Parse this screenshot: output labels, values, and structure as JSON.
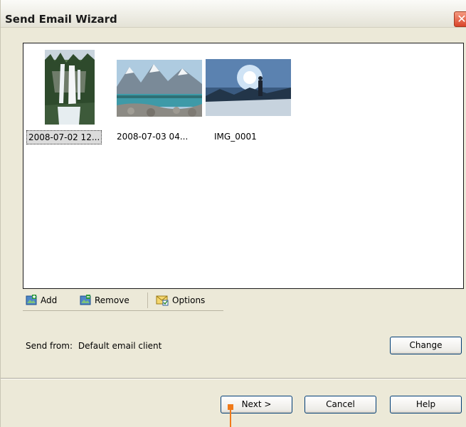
{
  "window": {
    "title": "Send Email Wizard",
    "close_glyph": "✕"
  },
  "files": [
    {
      "caption": "2008-07-02 12...",
      "thumbnail": "waterfall-forest"
    },
    {
      "caption": "2008-07-03 04...",
      "thumbnail": "mountain-lake"
    },
    {
      "caption": "IMG_0001",
      "thumbnail": "sun-hiker"
    }
  ],
  "toolbar": {
    "add_label": "Add",
    "remove_label": "Remove",
    "options_label": "Options"
  },
  "send_from": {
    "label": "Send from:",
    "value": "Default email client"
  },
  "buttons": {
    "change": "Change",
    "next": "Next >",
    "cancel": "Cancel",
    "help": "Help"
  },
  "colors": {
    "face": "#ece9d8",
    "button_border": "#003c74",
    "cursor": "#f07a1a"
  }
}
